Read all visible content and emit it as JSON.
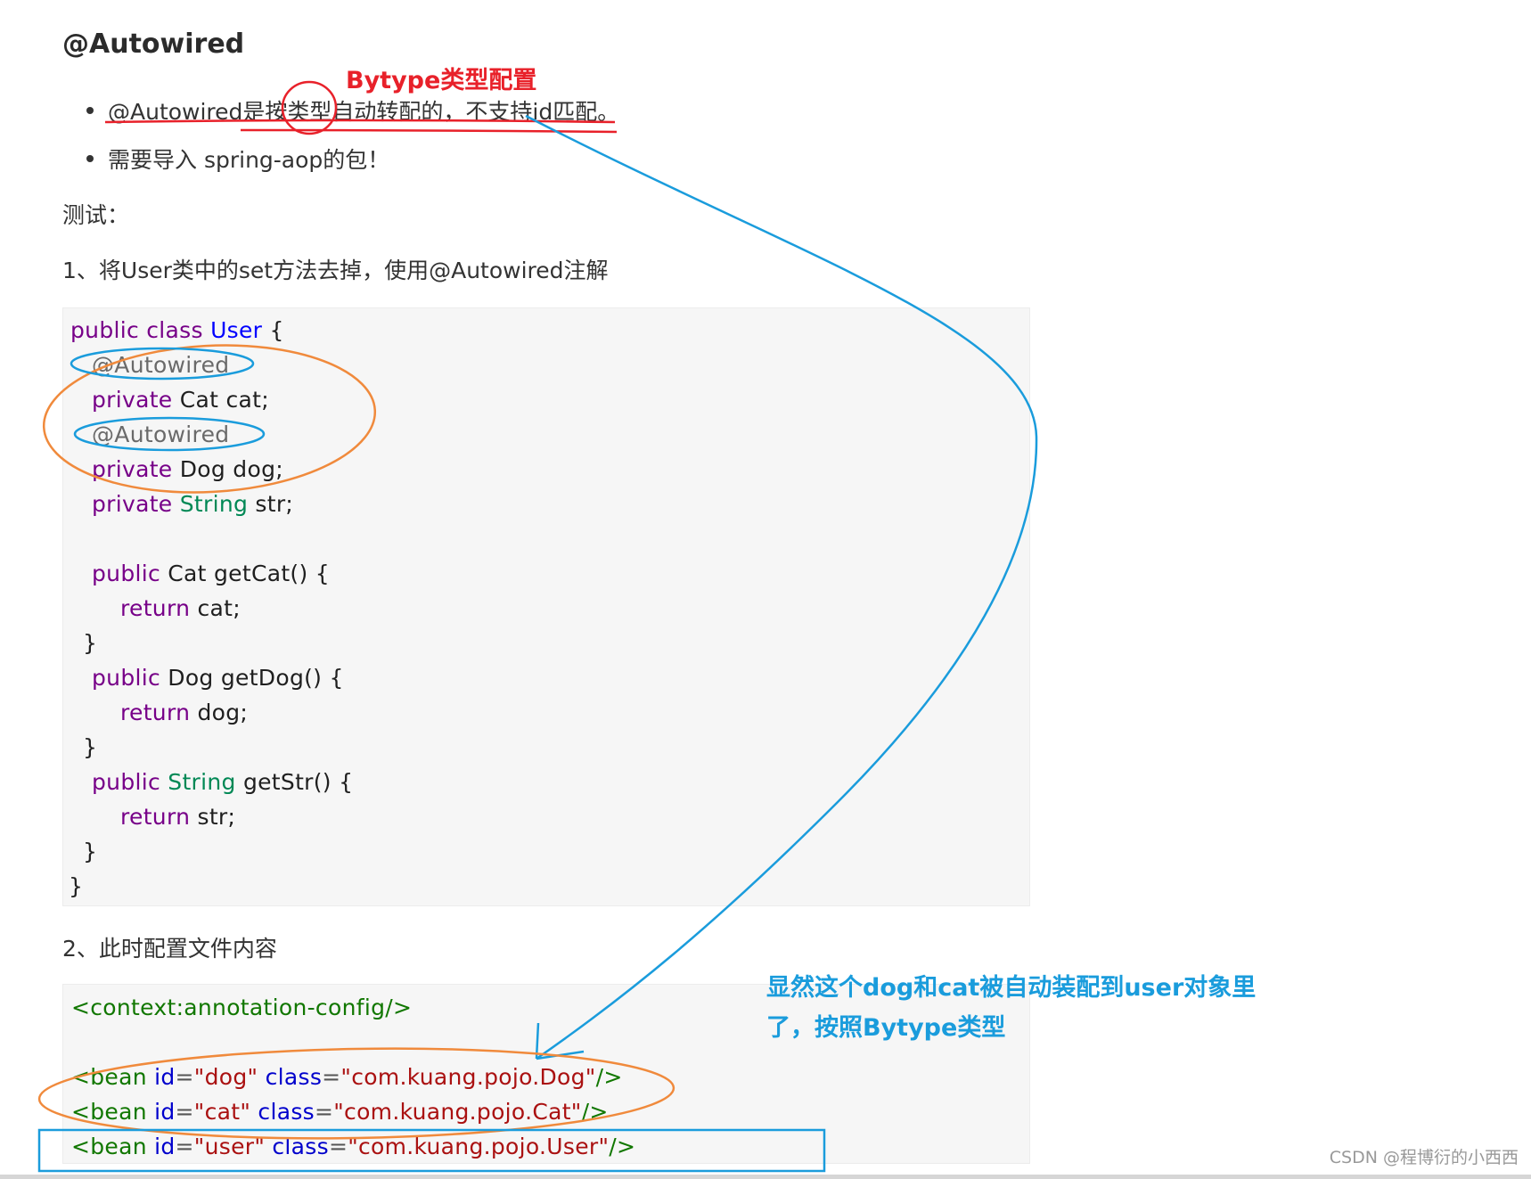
{
  "heading": "@Autowired",
  "annotation_red": "Bytype类型配置",
  "bullets": [
    "@Autowired是按类型自动转配的，不支持id匹配。",
    "需要导入 spring-aop的包！"
  ],
  "test_label": "测试：",
  "step1": "1、将User类中的set方法去掉，使用@Autowired注解",
  "code1": {
    "l1": {
      "kw": "public class",
      "name": "User",
      "rest": " {"
    },
    "l2": "@Autowired",
    "l3": {
      "kw": "private",
      "rest": " Cat cat;"
    },
    "l4": "@Autowired",
    "l5": {
      "kw": "private",
      "rest": " Dog dog;"
    },
    "l6": {
      "kw": "private",
      "type": "String",
      "rest": " str;"
    },
    "l7": {
      "kw": "public",
      "rest": " Cat getCat() {"
    },
    "l8": {
      "kw": "return",
      "rest": " cat;"
    },
    "l9": "}",
    "l10": {
      "kw": "public",
      "rest": " Dog getDog() {"
    },
    "l11": {
      "kw": "return",
      "rest": " dog;"
    },
    "l12": "}",
    "l13": {
      "kw": "public",
      "type": "String",
      "rest": " getStr() {"
    },
    "l14": {
      "kw": "return",
      "rest": " str;"
    },
    "l15": "}",
    "l16": "}"
  },
  "step2": "2、此时配置文件内容",
  "code2": {
    "context": "<context:annotation-config/>",
    "beans": [
      {
        "id": "\"dog\"",
        "cls": "\"com.kuang.pojo.Dog\""
      },
      {
        "id": "\"cat\"",
        "cls": "\"com.kuang.pojo.Cat\""
      },
      {
        "id": "\"user\"",
        "cls": "\"com.kuang.pojo.User\""
      }
    ],
    "bean_tag": "<bean",
    "id_attr": "id",
    "class_attr": "class",
    "eq": "=",
    "close": "/>"
  },
  "annotation_blue": {
    "line1": "显然这个dog和cat被自动装配到user对象里",
    "line2": "了，按照Bytype类型"
  },
  "watermark": "CSDN @程博衍的小西西",
  "colors": {
    "red": "#e8212a",
    "blue": "#1a9cdc",
    "orange": "#f08a3c"
  }
}
